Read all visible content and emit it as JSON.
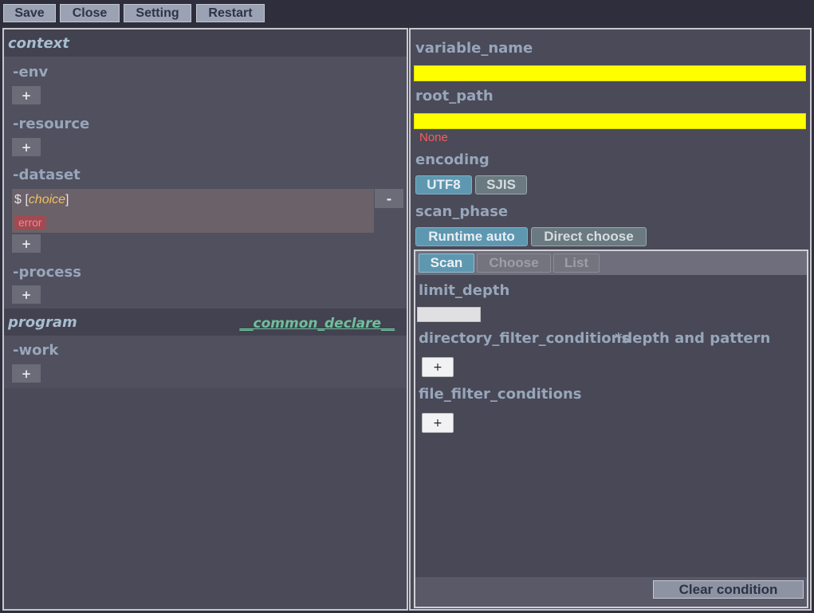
{
  "toolbar": {
    "save": "Save",
    "close": "Close",
    "setting": "Setting",
    "restart": "Restart"
  },
  "left": {
    "context_title": "context",
    "env_label": "-env",
    "resource_label": "-resource",
    "dataset_label": "-dataset",
    "dataset_item": {
      "prefix": "$ [",
      "choice": "choice",
      "suffix": "]",
      "error": "error"
    },
    "process_label": "-process",
    "program_title": "program",
    "common_declare": "__common_declare__",
    "work_label": "-work",
    "plus": "+",
    "minus": "-"
  },
  "right": {
    "variable_name_label": "variable_name",
    "root_path_label": "root_path",
    "none_text": "None",
    "encoding_label": "encoding",
    "encoding_options": [
      "UTF8",
      "SJIS"
    ],
    "encoding_selected": "UTF8",
    "scan_phase_label": "scan_phase",
    "scan_phase_options": [
      "Runtime auto",
      "Direct choose"
    ],
    "scan_phase_selected": "Runtime auto",
    "sub_tabs": [
      "Scan",
      "Choose",
      "List"
    ],
    "sub_tab_selected": "Scan",
    "limit_depth_label": "limit_depth",
    "dir_filter_label": "directory_filter_conditions",
    "dir_filter_note": "*depth and pattern",
    "file_filter_label": "file_filter_conditions",
    "plus": "+",
    "clear_condition": "Clear condition"
  },
  "colors": {
    "highlight_yellow": "#ffff00",
    "accent_blue": "#5e97b0",
    "error_red": "#ff5a5a"
  }
}
